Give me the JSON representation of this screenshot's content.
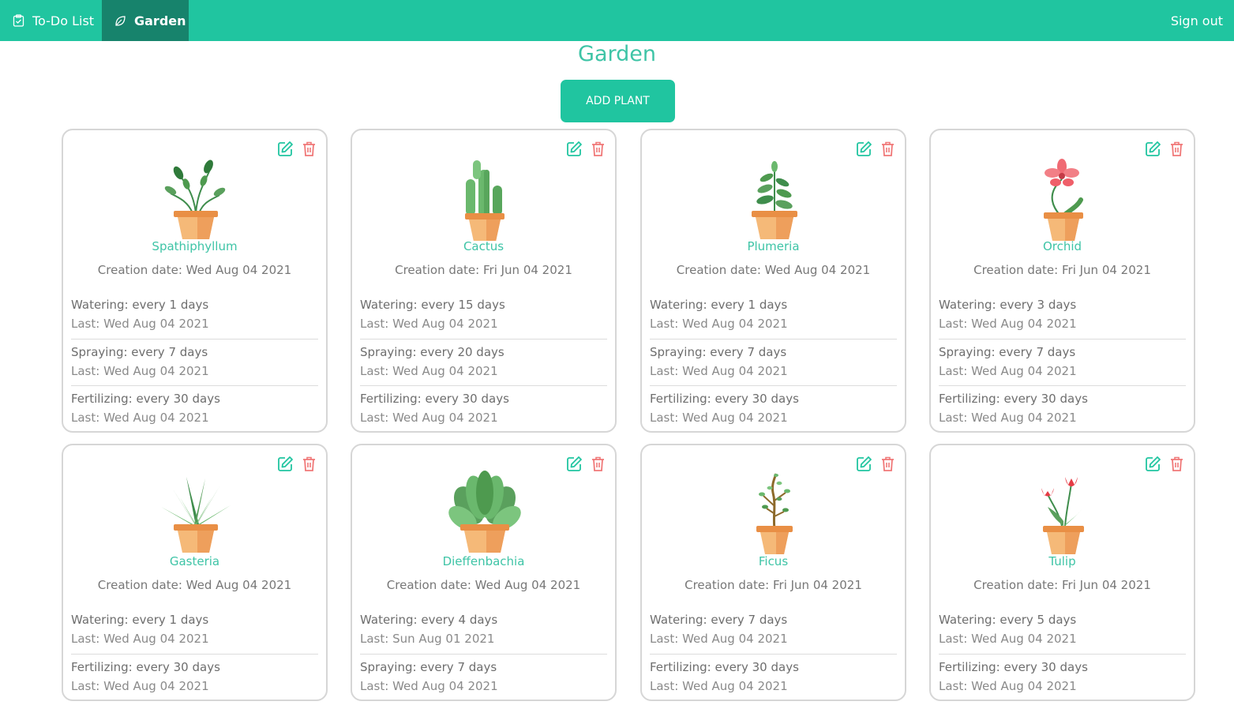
{
  "nav": {
    "todo_label": "To-Do List",
    "garden_label": "Garden",
    "signout_label": "Sign out"
  },
  "page": {
    "title": "Garden",
    "add_button_label": "ADD PLANT"
  },
  "colors": {
    "accent": "#20c5a0",
    "accent_dark": "#17836c",
    "edit_icon": "#20c5a0",
    "delete_icon": "#f07878"
  },
  "plants": [
    {
      "icon": "plant-spathiphyllum",
      "name": "Spathiphyllum",
      "creation": "Creation date: Wed Aug 04 2021",
      "tasks": [
        {
          "label": "Watering: every 1 days",
          "last": "Last: Wed Aug 04 2021"
        },
        {
          "label": "Spraying: every 7 days",
          "last": "Last: Wed Aug 04 2021"
        },
        {
          "label": "Fertilizing: every 30 days",
          "last": "Last: Wed Aug 04 2021"
        }
      ]
    },
    {
      "icon": "plant-cactus",
      "name": "Cactus",
      "creation": "Creation date: Fri Jun 04 2021",
      "tasks": [
        {
          "label": "Watering: every 15 days",
          "last": "Last: Wed Aug 04 2021"
        },
        {
          "label": "Spraying: every 20 days",
          "last": "Last: Wed Aug 04 2021"
        },
        {
          "label": "Fertilizing: every 30 days",
          "last": "Last: Wed Aug 04 2021"
        }
      ]
    },
    {
      "icon": "plant-plumeria",
      "name": "Plumeria",
      "creation": "Creation date: Wed Aug 04 2021",
      "tasks": [
        {
          "label": "Watering: every 1 days",
          "last": "Last: Wed Aug 04 2021"
        },
        {
          "label": "Spraying: every 7 days",
          "last": "Last: Wed Aug 04 2021"
        },
        {
          "label": "Fertilizing: every 30 days",
          "last": "Last: Wed Aug 04 2021"
        }
      ]
    },
    {
      "icon": "plant-orchid",
      "name": "Orchid",
      "creation": "Creation date: Fri Jun 04 2021",
      "tasks": [
        {
          "label": "Watering: every 3 days",
          "last": "Last: Wed Aug 04 2021"
        },
        {
          "label": "Spraying: every 7 days",
          "last": "Last: Wed Aug 04 2021"
        },
        {
          "label": "Fertilizing: every 30 days",
          "last": "Last: Wed Aug 04 2021"
        }
      ]
    },
    {
      "icon": "plant-gasteria",
      "name": "Gasteria",
      "creation": "Creation date: Wed Aug 04 2021",
      "tasks": [
        {
          "label": "Watering: every 1 days",
          "last": "Last: Wed Aug 04 2021"
        },
        {
          "label": "Fertilizing: every 30 days",
          "last": "Last: Wed Aug 04 2021"
        }
      ]
    },
    {
      "icon": "plant-dieffenbachia",
      "name": "Dieffenbachia",
      "creation": "Creation date: Wed Aug 04 2021",
      "tasks": [
        {
          "label": "Watering: every 4 days",
          "last": "Last: Sun Aug 01 2021"
        },
        {
          "label": "Spraying: every 7 days",
          "last": "Last: Wed Aug 04 2021"
        }
      ]
    },
    {
      "icon": "plant-ficus",
      "name": "Ficus",
      "creation": "Creation date: Fri Jun 04 2021",
      "tasks": [
        {
          "label": "Watering: every 7 days",
          "last": "Last: Wed Aug 04 2021"
        },
        {
          "label": "Fertilizing: every 30 days",
          "last": "Last: Wed Aug 04 2021"
        }
      ]
    },
    {
      "icon": "plant-tulip",
      "name": "Tulip",
      "creation": "Creation date: Fri Jun 04 2021",
      "tasks": [
        {
          "label": "Watering: every 5 days",
          "last": "Last: Wed Aug 04 2021"
        },
        {
          "label": "Fertilizing: every 30 days",
          "last": "Last: Wed Aug 04 2021"
        }
      ]
    }
  ]
}
